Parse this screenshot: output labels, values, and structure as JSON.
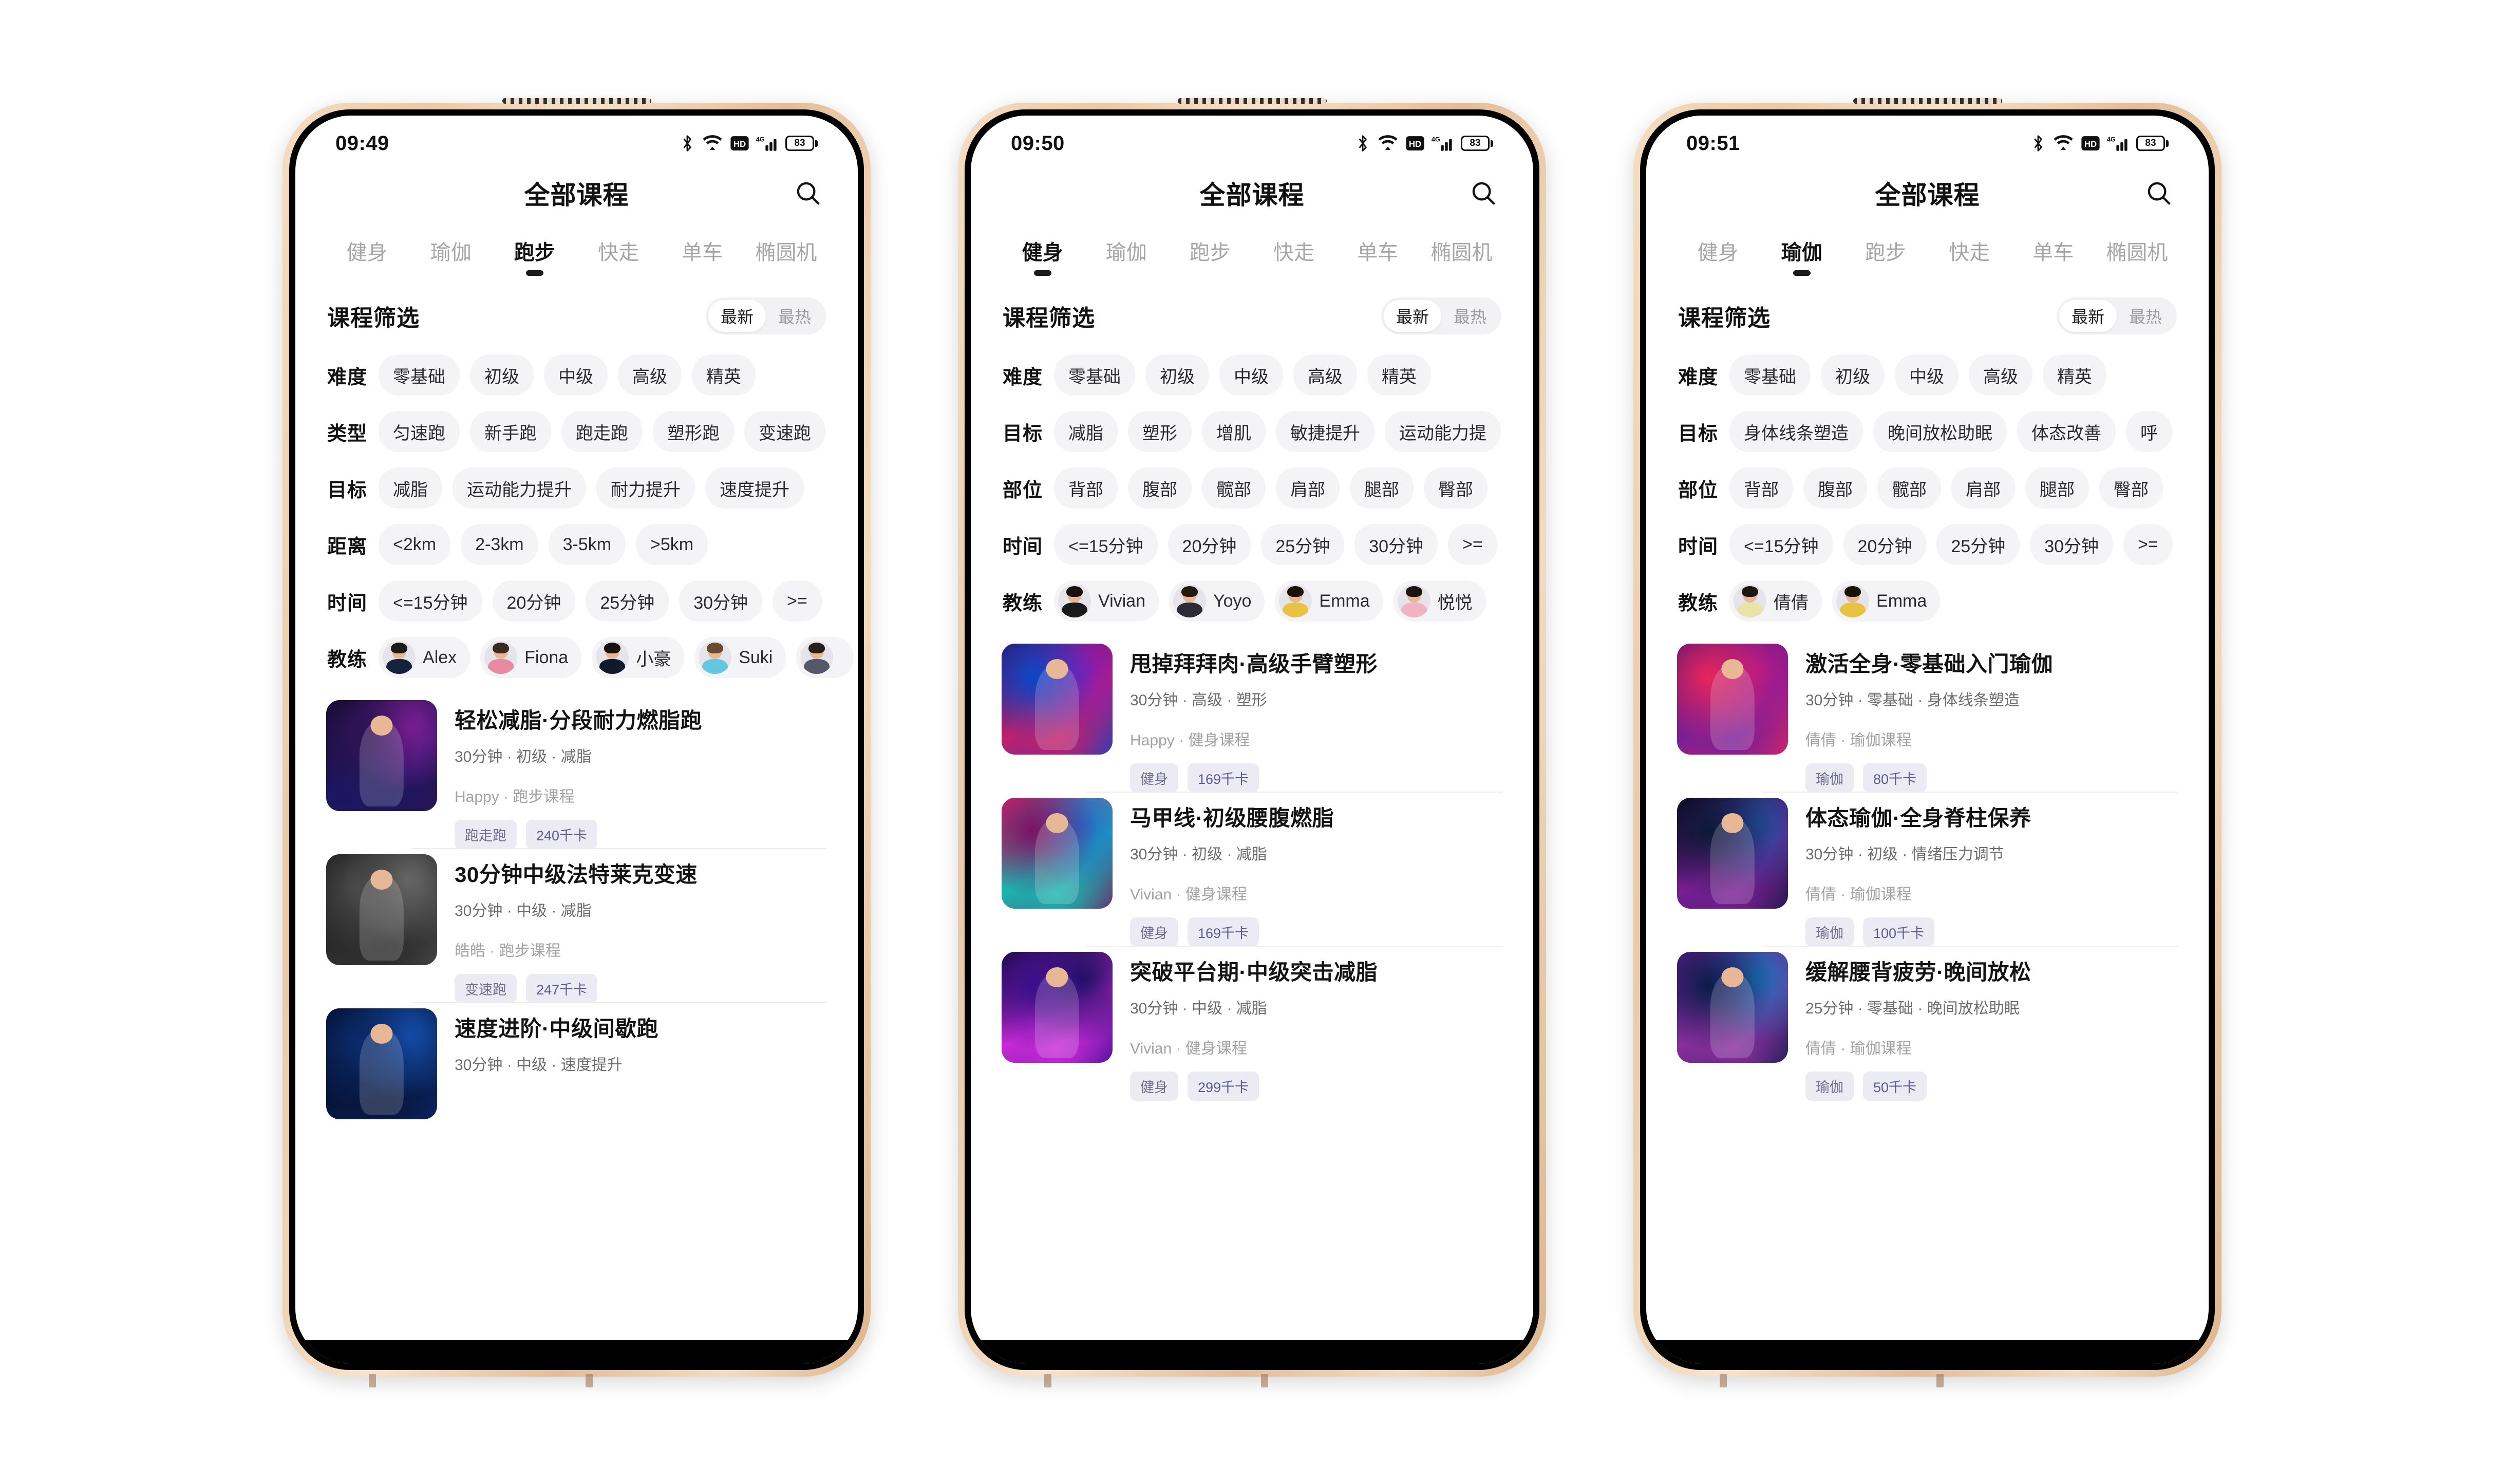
{
  "phones": [
    {
      "id": "phone-running",
      "statusbar": {
        "time": "09:49",
        "battery": "83",
        "network": "4G",
        "hd": "HD"
      },
      "navbar": {
        "title": "全部课程",
        "search_icon": "search-icon"
      },
      "tabs": [
        {
          "label": "健身",
          "active": false
        },
        {
          "label": "瑜伽",
          "active": false
        },
        {
          "label": "跑步",
          "active": true
        },
        {
          "label": "快走",
          "active": false
        },
        {
          "label": "单车",
          "active": false
        },
        {
          "label": "椭圆机",
          "active": false
        }
      ],
      "filter_header": {
        "title": "课程筛选",
        "sort": [
          {
            "label": "最新",
            "active": true
          },
          {
            "label": "最热",
            "active": false
          }
        ]
      },
      "filter_rows": [
        {
          "label": "难度",
          "chips": [
            "零基础",
            "初级",
            "中级",
            "高级",
            "精英"
          ]
        },
        {
          "label": "类型",
          "chips": [
            "匀速跑",
            "新手跑",
            "跑走跑",
            "塑形跑",
            "变速跑"
          ]
        },
        {
          "label": "目标",
          "chips": [
            "减脂",
            "运动能力提升",
            "耐力提升",
            "速度提升"
          ]
        },
        {
          "label": "距离",
          "chips": [
            "<2km",
            "2-3km",
            "3-5km",
            ">5km"
          ]
        },
        {
          "label": "时间",
          "chips": [
            "<=15分钟",
            "20分钟",
            "25分钟",
            "30分钟",
            ">="
          ]
        }
      ],
      "coach_row": {
        "label": "教练",
        "coaches": [
          {
            "name": "Alex",
            "hair": "#1e1a16",
            "shirt": "#14223b"
          },
          {
            "name": "Fiona",
            "hair": "#3a2a20",
            "shirt": "#e88aa0"
          },
          {
            "name": "小豪",
            "hair": "#15120f",
            "shirt": "#101a2c"
          },
          {
            "name": "Suki",
            "hair": "#6a4a2e",
            "shirt": "#63c7e0"
          },
          {
            "name": "",
            "hair": "#2a2019",
            "shirt": "#55586a"
          }
        ]
      },
      "courses": [
        {
          "title": "轻松减脂·分段耐力燃脂跑",
          "meta": "30分钟 · 初级 · 减脂",
          "coach": "Happy · 跑步课程",
          "tags": [
            "跑走跑",
            "240千卡"
          ],
          "thumb_colors": [
            "#2d1352",
            "#8a1f9e",
            "#1b1760",
            "#0c0822"
          ]
        },
        {
          "title": "30分钟中级法特莱克变速",
          "meta": "30分钟 · 中级 · 减脂",
          "coach": "皓皓 · 跑步课程",
          "tags": [
            "变速跑",
            "247千卡"
          ],
          "thumb_colors": [
            "#4a4a4a",
            "#6e6e6e",
            "#2a2a2a",
            "#111111"
          ]
        },
        {
          "title": "速度进阶·中级间歇跑",
          "meta": "30分钟 · 中级 · 速度提升",
          "coach": "",
          "tags": [],
          "thumb_colors": [
            "#0b2a6b",
            "#1554b8",
            "#07153c",
            "#030a1e"
          ]
        }
      ]
    },
    {
      "id": "phone-fitness",
      "statusbar": {
        "time": "09:50",
        "battery": "83",
        "network": "4G",
        "hd": "HD"
      },
      "navbar": {
        "title": "全部课程",
        "search_icon": "search-icon"
      },
      "tabs": [
        {
          "label": "健身",
          "active": true
        },
        {
          "label": "瑜伽",
          "active": false
        },
        {
          "label": "跑步",
          "active": false
        },
        {
          "label": "快走",
          "active": false
        },
        {
          "label": "单车",
          "active": false
        },
        {
          "label": "椭圆机",
          "active": false
        }
      ],
      "filter_header": {
        "title": "课程筛选",
        "sort": [
          {
            "label": "最新",
            "active": true
          },
          {
            "label": "最热",
            "active": false
          }
        ]
      },
      "filter_rows": [
        {
          "label": "难度",
          "chips": [
            "零基础",
            "初级",
            "中级",
            "高级",
            "精英"
          ]
        },
        {
          "label": "目标",
          "chips": [
            "减脂",
            "塑形",
            "增肌",
            "敏捷提升",
            "运动能力提"
          ]
        },
        {
          "label": "部位",
          "chips": [
            "背部",
            "腹部",
            "髋部",
            "肩部",
            "腿部",
            "臀部"
          ]
        },
        {
          "label": "时间",
          "chips": [
            "<=15分钟",
            "20分钟",
            "25分钟",
            "30分钟",
            ">="
          ]
        }
      ],
      "coach_row": {
        "label": "教练",
        "coaches": [
          {
            "name": "Vivian",
            "hair": "#1a120c",
            "shirt": "#1a1a1a"
          },
          {
            "name": "Yoyo",
            "hair": "#241811",
            "shirt": "#2c2c34"
          },
          {
            "name": "Emma",
            "hair": "#191208",
            "shirt": "#e8c341"
          },
          {
            "name": "悦悦",
            "hair": "#1c1410",
            "shirt": "#efb3c4"
          }
        ]
      },
      "courses": [
        {
          "title": "甩掉拜拜肉·高级手臂塑形",
          "meta": "30分钟 · 高级 · 塑形",
          "coach": "Happy · 健身课程",
          "tags": [
            "健身",
            "169千卡"
          ],
          "thumb_colors": [
            "#0a46c8",
            "#8c1bb5",
            "#c21f6b",
            "#2a0f5e"
          ]
        },
        {
          "title": "马甲线·初级腰腹燃脂",
          "meta": "30分钟 · 初级 · 减脂",
          "coach": "Vivian · 健身课程",
          "tags": [
            "健身",
            "169千卡"
          ],
          "thumb_colors": [
            "#7a1361",
            "#1f6fd0",
            "#19b6b0",
            "#e3226a"
          ]
        },
        {
          "title": "突破平台期·中级突击减脂",
          "meta": "30分钟 · 中级 · 减脂",
          "coach": "Vivian · 健身课程",
          "tags": [
            "健身",
            "299千卡"
          ],
          "thumb_colors": [
            "#3a0f8c",
            "#1b1060",
            "#c82ad6",
            "#0c0726"
          ]
        }
      ]
    },
    {
      "id": "phone-yoga",
      "statusbar": {
        "time": "09:51",
        "battery": "83",
        "network": "4G",
        "hd": "HD"
      },
      "navbar": {
        "title": "全部课程",
        "search_icon": "search-icon"
      },
      "tabs": [
        {
          "label": "健身",
          "active": false
        },
        {
          "label": "瑜伽",
          "active": true
        },
        {
          "label": "跑步",
          "active": false
        },
        {
          "label": "快走",
          "active": false
        },
        {
          "label": "单车",
          "active": false
        },
        {
          "label": "椭圆机",
          "active": false
        }
      ],
      "filter_header": {
        "title": "课程筛选",
        "sort": [
          {
            "label": "最新",
            "active": true
          },
          {
            "label": "最热",
            "active": false
          }
        ]
      },
      "filter_rows": [
        {
          "label": "难度",
          "chips": [
            "零基础",
            "初级",
            "中级",
            "高级",
            "精英"
          ]
        },
        {
          "label": "目标",
          "chips": [
            "身体线条塑造",
            "晚间放松助眠",
            "体态改善",
            "呼"
          ]
        },
        {
          "label": "部位",
          "chips": [
            "背部",
            "腹部",
            "髋部",
            "肩部",
            "腿部",
            "臀部"
          ]
        },
        {
          "label": "时间",
          "chips": [
            "<=15分钟",
            "20分钟",
            "25分钟",
            "30分钟",
            ">="
          ]
        }
      ],
      "coach_row": {
        "label": "教练",
        "coaches": [
          {
            "name": "倩倩",
            "hair": "#1d1510",
            "shirt": "#e8e3a8"
          },
          {
            "name": "Emma",
            "hair": "#191208",
            "shirt": "#e8c341"
          }
        ]
      },
      "courses": [
        {
          "title": "激活全身·零基础入门瑜伽",
          "meta": "30分钟 · 零基础 · 身体线条塑造",
          "coach": "倩倩 · 瑜伽课程",
          "tags": [
            "瑜伽",
            "80千卡"
          ],
          "thumb_colors": [
            "#e8265c",
            "#b21a8a",
            "#7a1f96",
            "#4a1070"
          ]
        },
        {
          "title": "体态瑜伽·全身脊柱保养",
          "meta": "30分钟 · 初级 · 情绪压力调节",
          "coach": "倩倩 · 瑜伽课程",
          "tags": [
            "瑜伽",
            "100千卡"
          ],
          "thumb_colors": [
            "#0d1838",
            "#1e4f9c",
            "#7a1f96",
            "#0a0618"
          ]
        },
        {
          "title": "缓解腰背疲劳·晚间放松",
          "meta": "25分钟 · 零基础 · 晚间放松助眠",
          "coach": "倩倩 · 瑜伽课程",
          "tags": [
            "瑜伽",
            "50千卡"
          ],
          "thumb_colors": [
            "#0a1c4a",
            "#1673b8",
            "#8a2f9e",
            "#5c1888"
          ]
        }
      ]
    }
  ],
  "colors": {
    "accent_dark": "#1b1b1b",
    "chip_bg": "#f4f4f6",
    "tag_bg": "#eceaf3",
    "tag_text": "#6e6e8c",
    "muted": "#a6a6a6",
    "frame_gold": "#e9c9a6"
  }
}
